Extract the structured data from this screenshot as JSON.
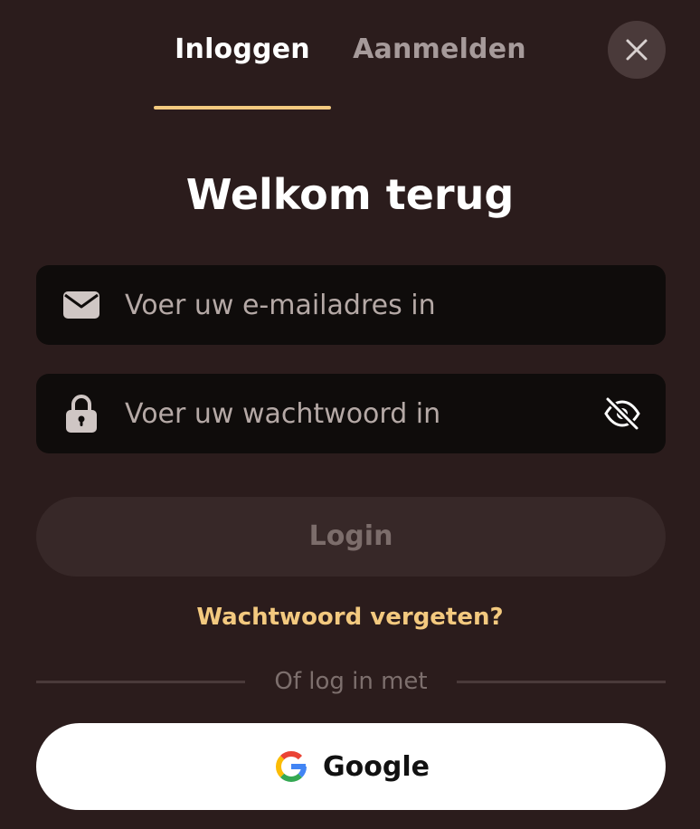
{
  "tabs": {
    "login_label": "Inloggen",
    "register_label": "Aanmelden",
    "active": "login"
  },
  "title": "Welkom terug",
  "email_field": {
    "value": "",
    "placeholder": "Voer uw e-mailadres in"
  },
  "password_field": {
    "value": "",
    "placeholder": "Voer uw wachtwoord in"
  },
  "login_button": {
    "label": "Login",
    "disabled": true
  },
  "forgot_password_label": "Wachtwoord vergeten?",
  "divider_label": "Of log in met",
  "google_button": {
    "label": "Google"
  },
  "icons": {
    "close": "close-icon",
    "email": "envelope-icon",
    "password": "lock-icon",
    "visibility": "eye-off-icon",
    "google": "google-logo-icon"
  },
  "colors": {
    "background": "#2b1c1c",
    "accent": "#f3c97f",
    "field_background": "#0f0c0b",
    "button_disabled": "#372828"
  }
}
